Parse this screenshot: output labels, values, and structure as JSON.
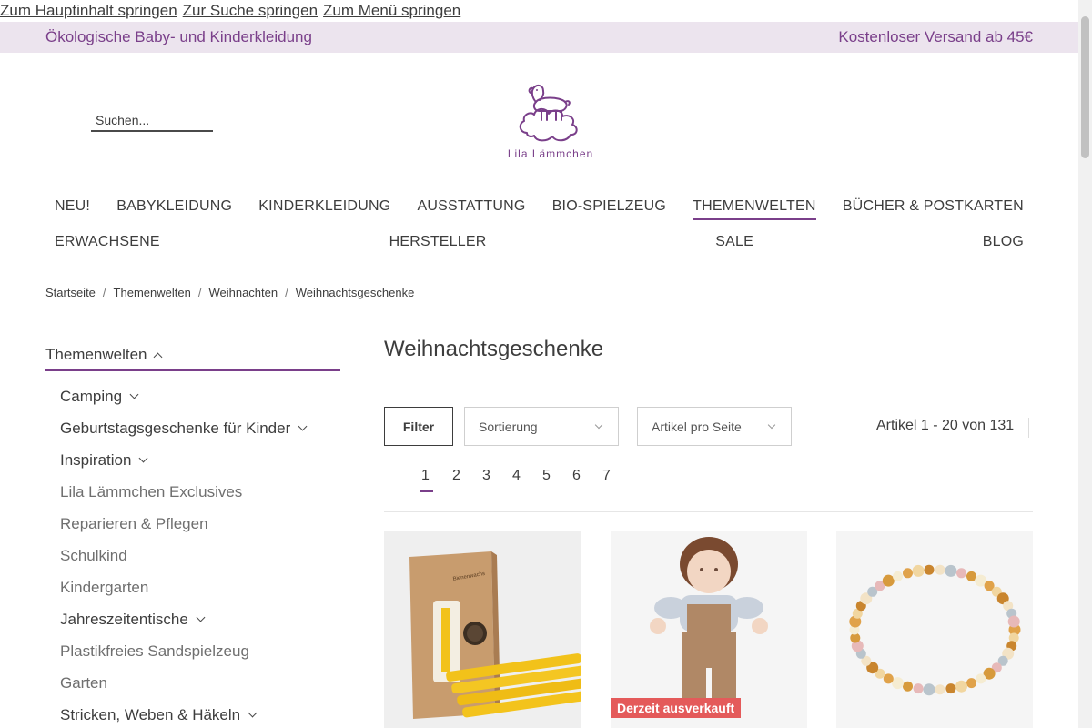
{
  "skip_links": [
    "Zum Hauptinhalt springen",
    "Zur Suche springen",
    "Zum Menü springen"
  ],
  "topbar": {
    "left": "Ökologische Baby- und Kinderkleidung",
    "right": "Kostenloser Versand ab 45€"
  },
  "search": {
    "placeholder": "Suchen..."
  },
  "logo": {
    "text": "Lila Lämmchen"
  },
  "nav": {
    "row1": [
      "NEU!",
      "BABYKLEIDUNG",
      "KINDERKLEIDUNG",
      "AUSSTATTUNG",
      "BIO-SPIELZEUG",
      "THEMENWELTEN",
      "BÜCHER & POSTKARTEN"
    ],
    "row2": [
      "ERWACHSENE",
      "HERSTELLER",
      "SALE",
      "BLOG"
    ],
    "active": "THEMENWELTEN"
  },
  "breadcrumb": [
    "Startseite",
    "Themenwelten",
    "Weihnachten",
    "Weihnachtsgeschenke"
  ],
  "sidebar": {
    "heading": "Themenwelten",
    "items": [
      "Camping",
      "Geburtstagsgeschenke für Kinder",
      "Inspiration",
      "Lila Lämmchen Exclusives",
      "Reparieren & Pflegen",
      "Schulkind",
      "Kindergarten",
      "Jahreszeitentische",
      "Plastikfreies Sandspielzeug",
      "Garten",
      "Stricken, Weben & Häkeln"
    ]
  },
  "main": {
    "title": "Weihnachtsgeschenke",
    "filter_label": "Filter",
    "sort_label": "Sortierung",
    "perpage_label": "Artikel pro Seite",
    "count": "Artikel 1 - 20 von 131",
    "pages": [
      "1",
      "2",
      "3",
      "4",
      "5",
      "6",
      "7"
    ],
    "current_page": "1"
  },
  "products": {
    "badge": "Derzeit ausverkauft"
  },
  "colors": {
    "accent": "#7a3f8a",
    "topbar_bg": "#ece4ee",
    "badge": "#e45a5a"
  }
}
